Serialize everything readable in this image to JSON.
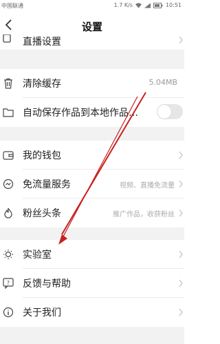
{
  "status_bar": {
    "carrier": "中国联通",
    "speed": "1.7 K/s",
    "battery": "80",
    "time": "10:51"
  },
  "nav": {
    "title": "设置"
  },
  "settings": {
    "live": {
      "label": "直播设置"
    },
    "cache": {
      "label": "清除缓存",
      "value": "5.04MB"
    },
    "autosave": {
      "label": "自动保存作品到本地作品…"
    },
    "wallet": {
      "label": "我的钱包"
    },
    "free_traffic": {
      "label": "免流量服务",
      "sub": "视频、直播免流量"
    },
    "fans_headline": {
      "label": "粉丝头条",
      "sub": "推广作品，收获粉丝"
    },
    "lab": {
      "label": "实验室"
    },
    "feedback": {
      "label": "反馈与帮助"
    },
    "about": {
      "label": "关于我们"
    }
  },
  "colors": {
    "annotation_arrow": "#c8201f"
  }
}
